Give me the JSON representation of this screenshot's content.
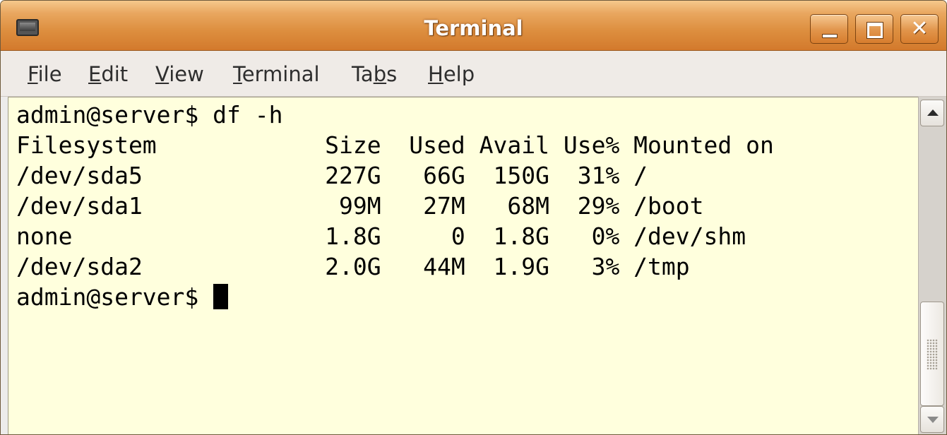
{
  "window": {
    "title": "Terminal",
    "close_glyph": "✕"
  },
  "menubar": {
    "items": [
      {
        "pre": "",
        "u": "F",
        "post": "ile"
      },
      {
        "pre": "",
        "u": "E",
        "post": "dit"
      },
      {
        "pre": "",
        "u": "V",
        "post": "iew"
      },
      {
        "pre": "",
        "u": "T",
        "post": "erminal"
      },
      {
        "pre": "Ta",
        "u": "b",
        "post": "s"
      },
      {
        "pre": "",
        "u": "H",
        "post": "elp"
      }
    ]
  },
  "terminal": {
    "lines": [
      "admin@server$ df -h",
      "Filesystem            Size  Used Avail Use% Mounted on",
      "/dev/sda5             227G   66G  150G  31% /",
      "/dev/sda1              99M   27M   68M  29% /boot",
      "none                  1.8G     0  1.8G   0% /dev/shm",
      "/dev/sda2             2.0G   44M  1.9G   3% /tmp"
    ],
    "prompt": "admin@server$ "
  },
  "icons": {
    "app": "terminal-app-icon",
    "minimize": "minimize-icon",
    "maximize": "maximize-icon",
    "close": "close-icon",
    "scroll_up": "arrow-up-icon",
    "scroll_down": "arrow-down-icon"
  },
  "colors": {
    "titlebar": "#dd8f3f",
    "terminal_bg": "#ffffdd",
    "terminal_fg": "#000000"
  }
}
